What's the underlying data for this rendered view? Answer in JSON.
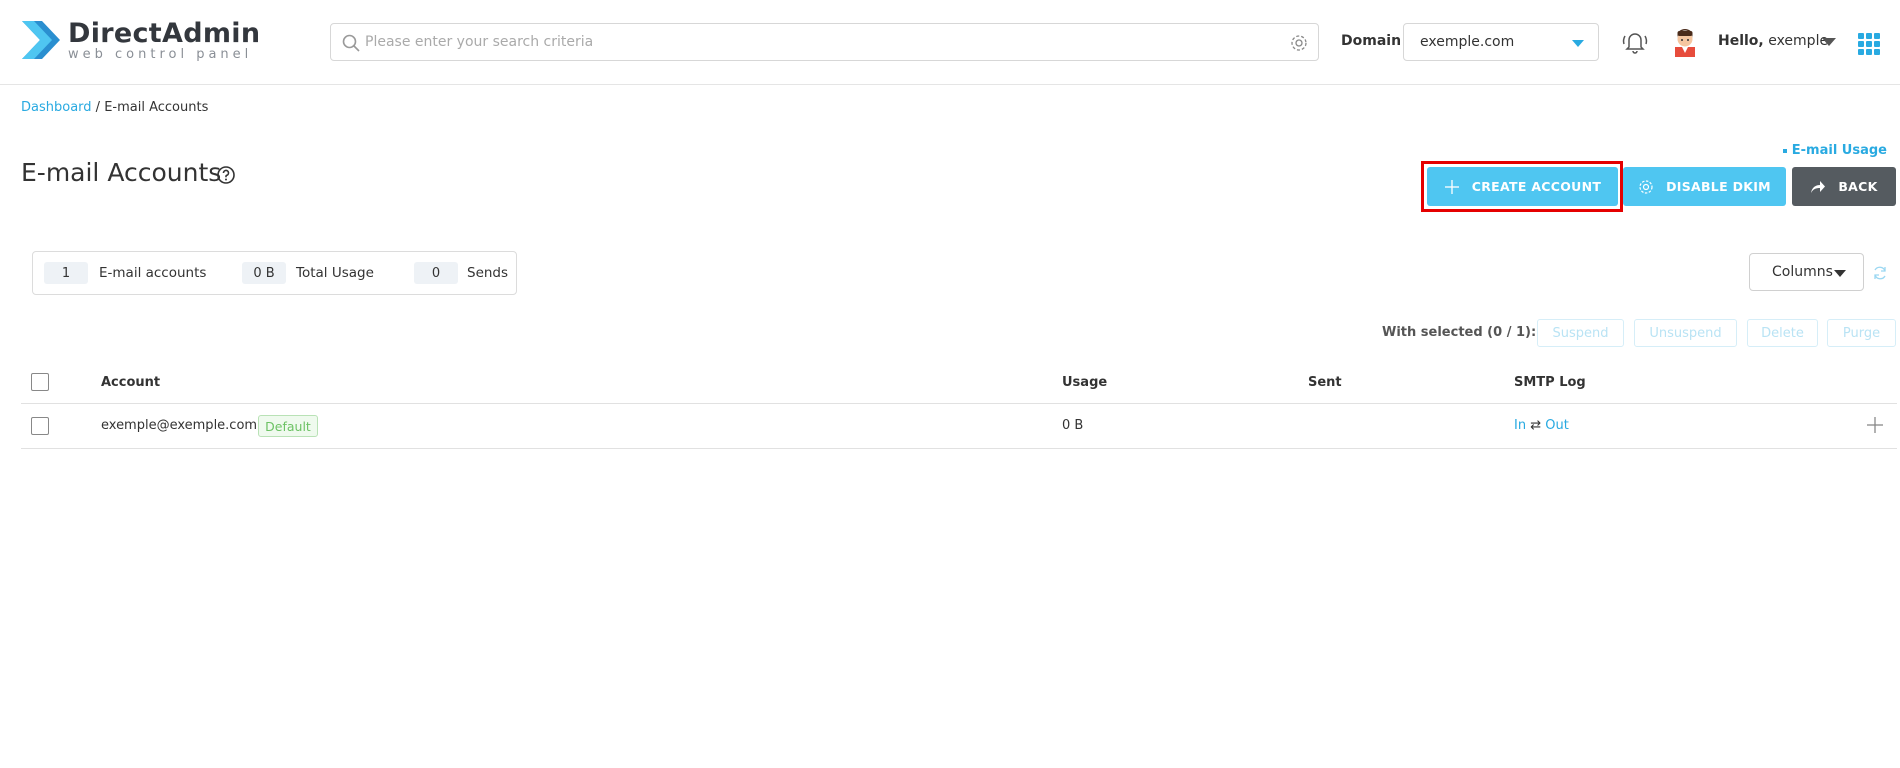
{
  "app": {
    "logo_title": "DirectAdmin",
    "logo_subtitle": "web control panel",
    "brand_color": "#29aae1"
  },
  "header": {
    "search_placeholder": "Please enter your search criteria",
    "domain_label": "Domain",
    "domain_value": "exemple.com",
    "hello_prefix": "Hello,",
    "username": "exemple"
  },
  "breadcrumb": {
    "home": "Dashboard",
    "separator": " / ",
    "current": "E-mail Accounts"
  },
  "page": {
    "title": "E-mail Accounts",
    "usage_link": "E-mail Usage",
    "create_label": "CREATE ACCOUNT",
    "dkim_label": "DISABLE DKIM",
    "back_label": "BACK"
  },
  "stats": {
    "accounts_count": "1",
    "accounts_label": "E-mail accounts",
    "usage_value": "0 B",
    "usage_label": "Total Usage",
    "sends_value": "0",
    "sends_label": "Sends"
  },
  "toolbar": {
    "columns_label": "Columns",
    "with_selected": "With selected (0 / 1):",
    "actions": [
      "Suspend",
      "Unsuspend",
      "Delete",
      "Purge"
    ]
  },
  "table": {
    "headers": [
      "Account",
      "Usage",
      "Sent",
      "SMTP Log"
    ],
    "rows": [
      {
        "account": "exemple@exemple.com",
        "badge": "Default",
        "usage": "0 B",
        "sent": "",
        "smtp_in": "In",
        "smtp_sep": "⇄",
        "smtp_out": "Out"
      }
    ]
  }
}
